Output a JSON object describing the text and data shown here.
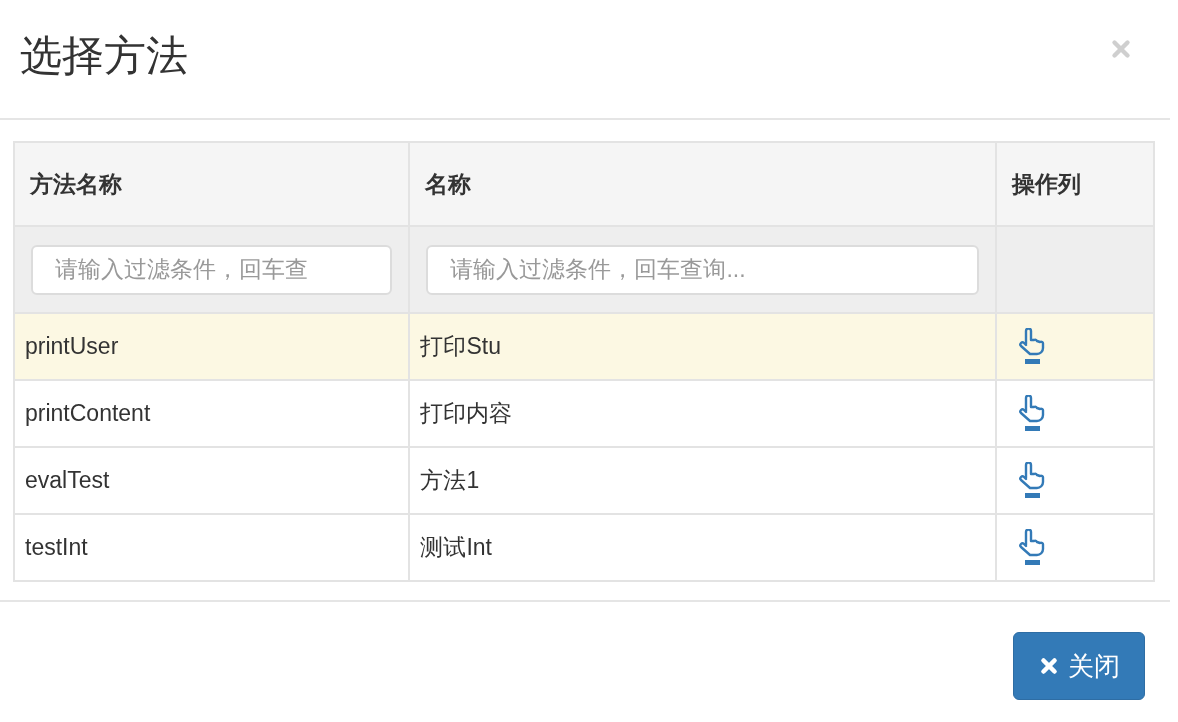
{
  "dialog": {
    "title": "选择方法"
  },
  "table": {
    "columns": [
      "方法名称",
      "名称",
      "操作列"
    ],
    "filters": [
      {
        "placeholder": "请输入过滤条件，回车查"
      },
      {
        "placeholder": "请输入过滤条件，回车查询..."
      }
    ],
    "rows": [
      {
        "method": "printUser",
        "name": "打印Stu",
        "selected": true
      },
      {
        "method": "printContent",
        "name": "打印内容",
        "selected": false
      },
      {
        "method": "evalTest",
        "name": "方法1",
        "selected": false
      },
      {
        "method": "testInt",
        "name": "测试Int",
        "selected": false
      }
    ]
  },
  "footer": {
    "close_button": "关闭"
  }
}
